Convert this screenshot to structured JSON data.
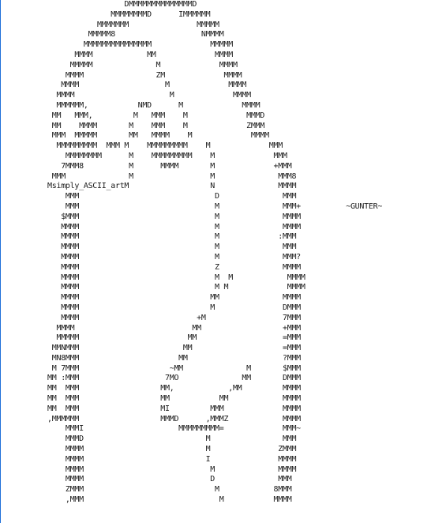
{
  "ascii_art": {
    "lines": [
      "                 DMMMMMMMMMMMMMMD",
      "              MMMMMMMMD      IMMMMMM",
      "           MMMMMMM               MMMMM",
      "         MMMMM8                   NMMMM",
      "        MMMMMMMMMMMMMMM             MMMMM",
      "      MMMM            MM             MMMM",
      "     MMMMM              M             MMMM",
      "    MMMM                ZM             MMMM",
      "   MMMM                   M             MMMM",
      "  MMMM                     M             MMMM",
      "  MMMMMM,           NMD      M             MMMM",
      " MM   MMM,         M   MMM    M             MMMD",
      " MM    MMMM       M    MMM    M             ZMMM",
      " MMM  MMMMM       MM   MMMM    M             MMMM",
      "  MMMMMMMMM  MMM M    MMMMMMMMM    M             MMM",
      "    MMMMMMMM      M    MMMMMMMMM    M             MMM",
      "   7MMM8          M      MMMM       M             +MMM",
      " MMM              M                 M              MMM8",
      "Msimply_ASCII_artM                  N              MMMM",
      "    MMM                              D              MMM",
      "    MMM                              M              MMM+          ~GUNTER~",
      "   $MMM                              M              MMMM",
      "   MMMM                              M              MMMM",
      "   MMMM                              M             :MMM",
      "   MMMM                              M              MMM",
      "   MMMM                              M              MMM?",
      "   MMMM                              Z              MMMM",
      "   MMMM                              M  M            MMMM",
      "   MMMM                              M M             MMMM",
      "   MMMM                             MM              MMMM",
      "   MMMM                             M               DMMM",
      "   MMMM                          +M                 7MMM",
      "  MMMM                          MM                  +MMM",
      "  MMMMM                        MM                   =MMM",
      " MMNMMM                       MM                    =MMM",
      " MN8MMM                      MM                     ?MMM",
      " M 7MMM                    ~MM              M       $MMM",
      "MM :MMM                   7MO              MM       DMMM",
      "MM  MMM                  MM,            ,MM         MMMM",
      "MM  MMM                  MM           MM            MMMM",
      "MM  MMM                  MI         MMM             MMMM",
      ",MMMMMM                  MMMD      ,MMMZ            MMMM",
      "    MMMI                     MMMMMMMMM=             MMM~",
      "    MMMD                           M                MMM",
      "    MMMM                           M               ZMMM",
      "    MMMM                           I               MMMM",
      "    MMMM                            M              MMMM",
      "    MMMM                            D              MMM",
      "    ZMMM                             M            8MMM",
      "    ,MMM                              M           MMMM"
    ]
  }
}
